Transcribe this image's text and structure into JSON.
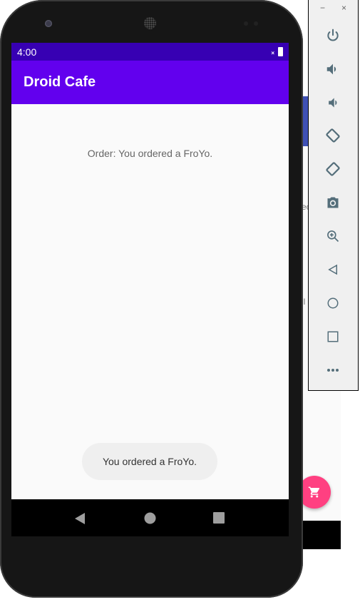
{
  "background_window": {
    "fragments": [
      "ec",
      "ll"
    ]
  },
  "status_bar": {
    "time": "4:00"
  },
  "app_bar": {
    "title": "Droid Cafe"
  },
  "main": {
    "order_text": "Order: You ordered a FroYo."
  },
  "toast": {
    "text": "You ordered a FroYo."
  },
  "colors": {
    "status_bar": "#3700b3",
    "app_bar": "#6200ee",
    "fab": "#ff4081",
    "toolbar_icon": "#546e7a"
  },
  "emulator_toolbar": {
    "window_buttons": [
      "−",
      "×"
    ],
    "icons": [
      "power-icon",
      "volume-up-icon",
      "volume-down-icon",
      "rotate-left-icon",
      "rotate-right-icon",
      "camera-icon",
      "zoom-icon",
      "back-icon",
      "home-icon",
      "overview-icon",
      "more-icon"
    ]
  }
}
